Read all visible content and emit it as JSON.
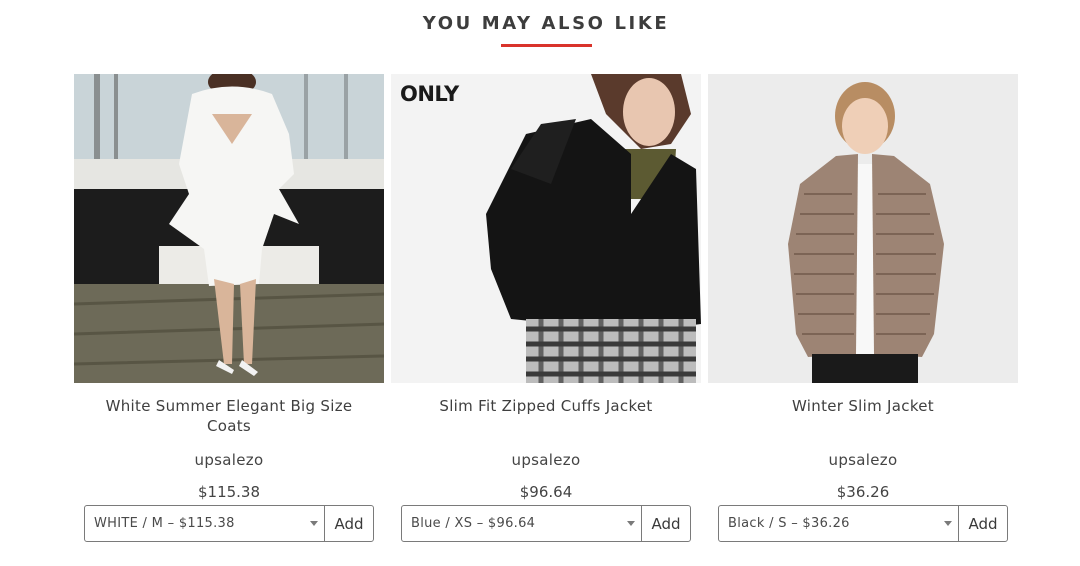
{
  "section": {
    "title": "YOU MAY ALSO LIKE",
    "accent_color": "#d9332b"
  },
  "products": [
    {
      "name": "White Summer Elegant Big Size Coats",
      "vendor": "upsalezo",
      "price": "$115.38",
      "variant": "WHITE / M – $115.38",
      "add_label": "Add",
      "image": "woman-white-peplum-dress-photo"
    },
    {
      "name": "Slim Fit Zipped Cuffs Jacket",
      "vendor": "upsalezo",
      "price": "$96.64",
      "variant": "Blue / XS – $96.64",
      "add_label": "Add",
      "image": "woman-black-suede-jacket-photo",
      "logo": "ONLY"
    },
    {
      "name": "Winter Slim Jacket",
      "vendor": "upsalezo",
      "price": "$36.26",
      "variant": "Black / S – $36.26",
      "add_label": "Add",
      "image": "woman-taupe-puffer-jacket-photo"
    }
  ]
}
